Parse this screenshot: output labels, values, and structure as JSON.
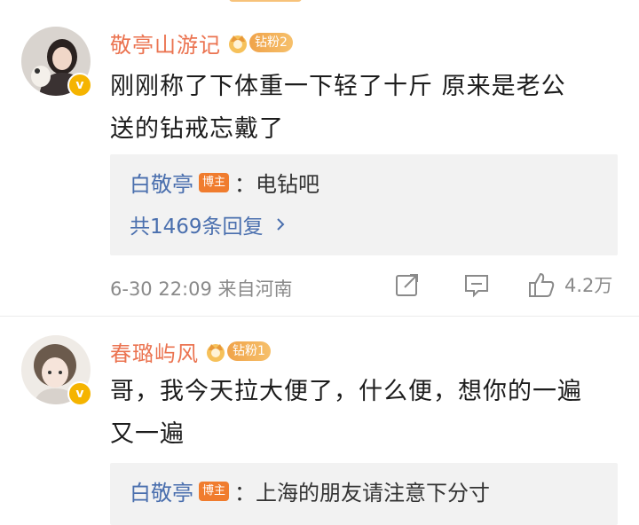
{
  "comments": [
    {
      "user": "敬亭山游记",
      "fan_badge": "钻粉2",
      "text_line1": "刚刚称了下体重一下轻了十斤  原来是老公",
      "text_line2": "送的钻戒忘戴了",
      "reply": {
        "user": "白敬亭",
        "badge": "博主",
        "text": "：电钻吧",
        "more": "共1469条回复"
      },
      "time_location": "6-30 22:09  来自河南",
      "likes": "4.2万"
    },
    {
      "user": "春璐屿风",
      "fan_badge": "钻粉1",
      "text_line1": "哥，我今天拉大便了，什么便，想你的一遍",
      "text_line2": "又一遍",
      "reply": {
        "user": "白敬亭",
        "badge": "博主",
        "text": "：上海的朋友请注意下分寸"
      }
    }
  ],
  "colors": {
    "name": "#eb7350",
    "link": "#4a6fae",
    "meta": "#8a8a8a",
    "reply_bg": "#f2f2f2",
    "verified": "#f5b400"
  }
}
